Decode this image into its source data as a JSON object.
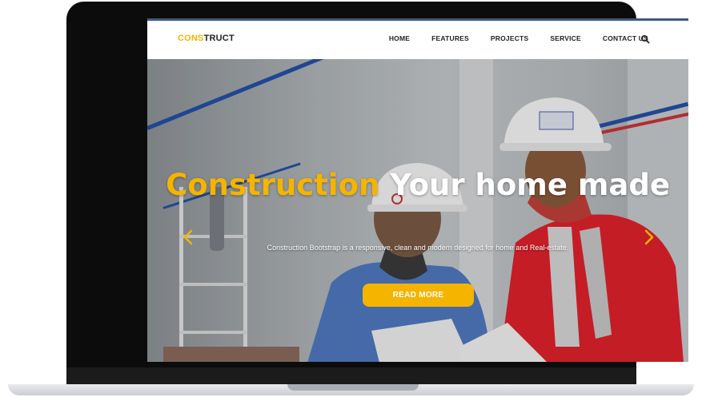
{
  "brand": {
    "part1": "CONS",
    "part2": "TRUCT"
  },
  "nav": {
    "items": [
      {
        "label": "HOME"
      },
      {
        "label": "FEATURES"
      },
      {
        "label": "PROJECTS"
      },
      {
        "label": "SERVICE"
      },
      {
        "label": "CONTACT US"
      }
    ],
    "search_icon": "search-icon"
  },
  "hero": {
    "headline_accent": "Construction",
    "headline_rest": " Your home made",
    "subtext": "Construction Bootstrap is a responsive, clean and modern designed for home and Real-estate.",
    "cta_label": "READ MORE",
    "prev_icon": "chevron-left-icon",
    "next_icon": "chevron-right-icon"
  },
  "colors": {
    "accent": "#f4b400",
    "nav_text": "#222222",
    "frame": "#0c0c0c"
  }
}
